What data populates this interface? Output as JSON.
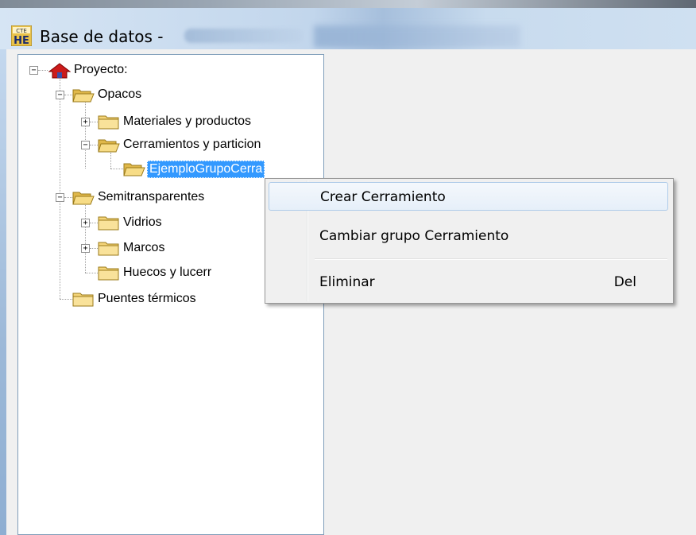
{
  "window": {
    "title": "Base de datos -"
  },
  "tree": {
    "root": "Proyecto:",
    "opacos": "Opacos",
    "materiales": "Materiales y productos",
    "cerramientos": "Cerramientos y particion",
    "ejemplo": "EjemploGrupoCerra",
    "semitransparentes": "Semitransparentes",
    "vidrios": "Vidrios",
    "marcos": "Marcos",
    "huecos": "Huecos y lucerr",
    "puentes": "Puentes térmicos"
  },
  "context_menu": {
    "items": [
      {
        "label": "Crear Cerramiento",
        "shortcut": ""
      },
      {
        "label": "Cambiar grupo Cerramiento",
        "shortcut": ""
      },
      {
        "label": "Eliminar",
        "shortcut": "Del"
      }
    ]
  },
  "colors": {
    "selection": "#3399ff",
    "folder": "#f5d57a"
  },
  "icons": {
    "app": "cte-he-app-icon",
    "root": "house-icon",
    "folder": "folder-icon"
  }
}
